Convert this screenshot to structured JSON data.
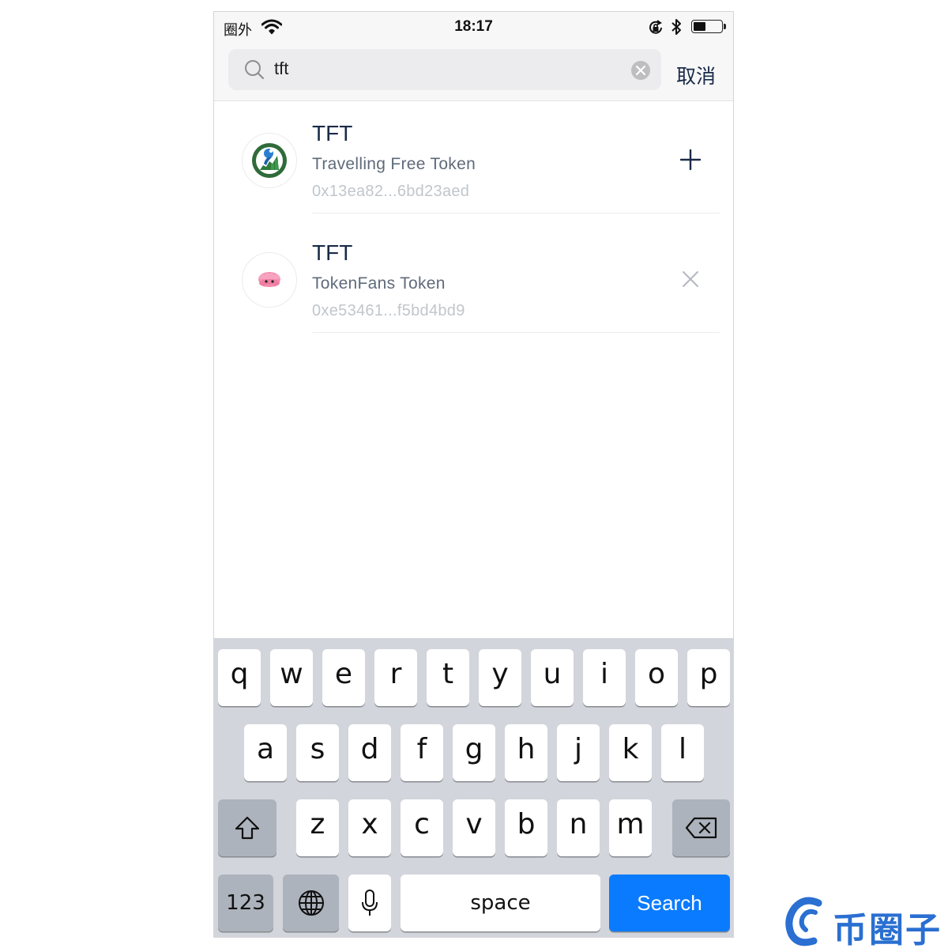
{
  "status_bar": {
    "carrier": "圈外",
    "time": "18:17",
    "battery_level": 0.45
  },
  "search": {
    "query": "tft",
    "cancel_label": "取消"
  },
  "results": [
    {
      "symbol": "TFT",
      "name": "Travelling Free Token",
      "address": "0x13ea82...6bd23aed",
      "action": "add-icon"
    },
    {
      "symbol": "TFT",
      "name": "TokenFans Token",
      "address": "0xe53461...f5bd4bd9",
      "action": "remove-icon"
    }
  ],
  "keyboard": {
    "row1": [
      "q",
      "w",
      "e",
      "r",
      "t",
      "y",
      "u",
      "i",
      "o",
      "p"
    ],
    "row2": [
      "a",
      "s",
      "d",
      "f",
      "g",
      "h",
      "j",
      "k",
      "l"
    ],
    "row3": [
      "z",
      "x",
      "c",
      "v",
      "b",
      "n",
      "m"
    ],
    "numbers_label": "123",
    "space_label": "space",
    "search_label": "Search",
    "search_color": "#0a7bff"
  },
  "watermark": {
    "text": "币圈子",
    "color": "#2a6fd1"
  }
}
